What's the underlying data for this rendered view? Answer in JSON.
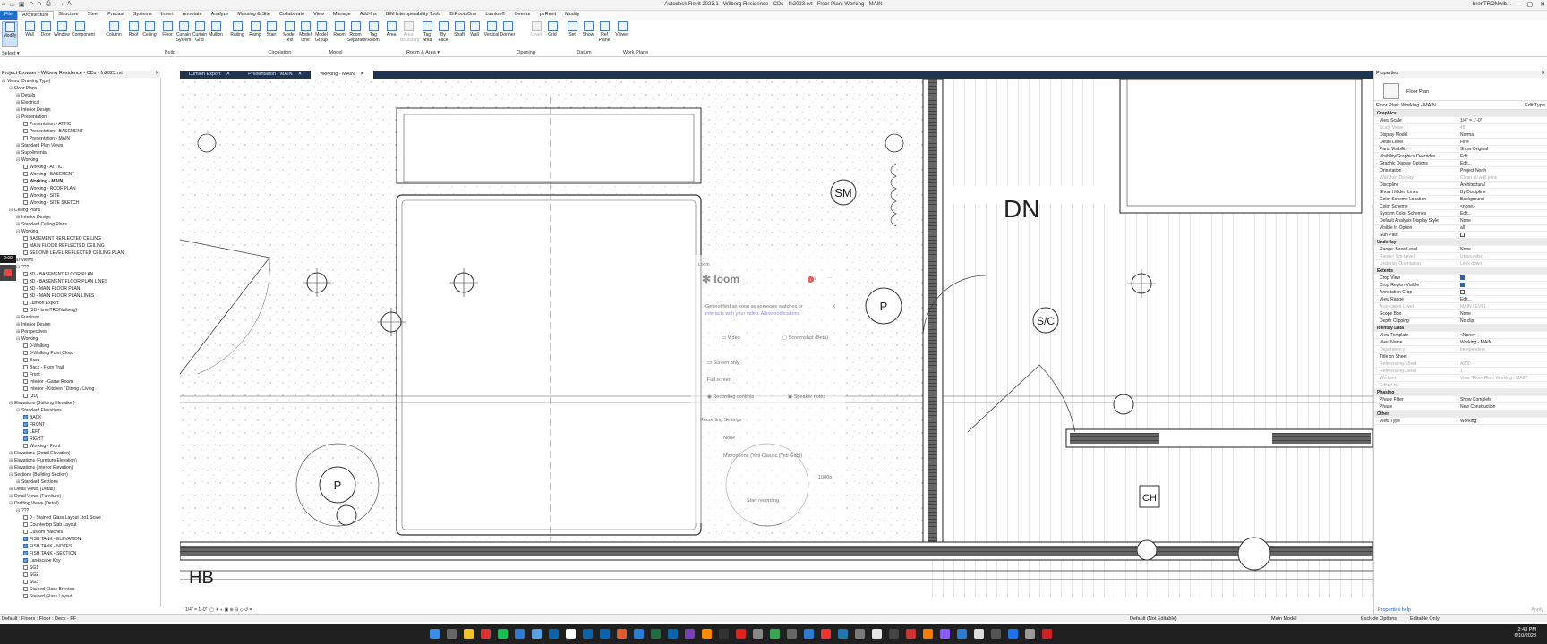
{
  "window": {
    "title": "Autodesk Revit 2023.1 - Wilberg Residence - CDs - fn2023.rvt - Floor Plan: Working - MAIN",
    "user": "brenTRONwib...",
    "qat_icons": [
      "home-icon",
      "open-icon",
      "save-icon",
      "undo-icon",
      "redo-icon",
      "print-icon",
      "measure-icon",
      "text-icon"
    ]
  },
  "ribbon": {
    "tabs": [
      "File",
      "Architecture",
      "Structure",
      "Steel",
      "Precast",
      "Systems",
      "Insert",
      "Annotate",
      "Analyze",
      "Massing & Site",
      "Collaborate",
      "View",
      "Manage",
      "Add-Ins",
      "BIM Interoperability Tools",
      "DiRootsOne",
      "Lumion®",
      "Overtur",
      "pyRevit",
      "Modify"
    ],
    "active_tab": "Architecture",
    "select_label": "Select ▾",
    "buttons": [
      "Modify",
      "Wall",
      "Door",
      "Window",
      "Component",
      "Column",
      "Roof",
      "Ceiling",
      "Floor",
      "Curtain System",
      "Curtain Grid",
      "Mullion",
      "Railing",
      "Ramp",
      "Stair",
      "Model Text",
      "Model Line",
      "Model Group",
      "Room",
      "Room Separator",
      "Tag Room",
      "Area",
      "Area Boundary",
      "Tag Area",
      "By Face",
      "Shaft",
      "Wall",
      "Vertical",
      "Dormer",
      "Level",
      "Grid",
      "Set",
      "Show",
      "Ref Plane",
      "Viewer"
    ],
    "panels": [
      "Build",
      "Circulation",
      "Model",
      "Room & Area ▾",
      "Opening",
      "Datum",
      "Work Plane"
    ]
  },
  "browser": {
    "title": "Project Browser - Wilberg Residence - CDs - fn2023.rvt",
    "items": [
      {
        "t": "Views (Drawing Type)",
        "l": 0,
        "tg": "⊟"
      },
      {
        "t": "Floor Plans",
        "l": 1,
        "tg": "⊟"
      },
      {
        "t": "Details",
        "l": 2,
        "tg": "⊞"
      },
      {
        "t": "Electrical",
        "l": 2,
        "tg": "⊞"
      },
      {
        "t": "Interior Design",
        "l": 2,
        "tg": "⊞"
      },
      {
        "t": "Presentation",
        "l": 2,
        "tg": "⊟"
      },
      {
        "t": "Presentation - ATTIC",
        "l": 3,
        "sq": 1
      },
      {
        "t": "Presentation - BASEMENT",
        "l": 3,
        "sq": 1
      },
      {
        "t": "Presentation - MAIN",
        "l": 3,
        "sq": 1
      },
      {
        "t": "Standard Plan Views",
        "l": 2,
        "tg": "⊞"
      },
      {
        "t": "Supplimental",
        "l": 2,
        "tg": "⊞"
      },
      {
        "t": "Working",
        "l": 2,
        "tg": "⊟"
      },
      {
        "t": "Working - ATTIC",
        "l": 3,
        "sq": 1
      },
      {
        "t": "Working - BASEMENT",
        "l": 3,
        "sq": 1
      },
      {
        "t": "Working - MAIN",
        "l": 3,
        "sq": 1,
        "b": 1
      },
      {
        "t": "Working - ROOF PLAN",
        "l": 3,
        "sq": 1
      },
      {
        "t": "Working - SITE",
        "l": 3,
        "sq": 1
      },
      {
        "t": "Working - SITE SKETCH",
        "l": 3,
        "sq": 1
      },
      {
        "t": "Ceiling Plans",
        "l": 1,
        "tg": "⊟"
      },
      {
        "t": "Interior Design",
        "l": 2,
        "tg": "⊞"
      },
      {
        "t": "Standard Ceiling Plans",
        "l": 2,
        "tg": "⊞"
      },
      {
        "t": "Working",
        "l": 2,
        "tg": "⊟"
      },
      {
        "t": "BASEMENT REFLECTED CEILING",
        "l": 3,
        "sq": 1
      },
      {
        "t": "MAIN FLOOR REFLECTED CEILING",
        "l": 3,
        "sq": 1
      },
      {
        "t": "SECOND LEVEL REFLECTED CEILING PLAN",
        "l": 3,
        "sq": 1
      },
      {
        "t": "3D Views",
        "l": 1,
        "tg": "⊟"
      },
      {
        "t": "???",
        "l": 2,
        "tg": "⊟"
      },
      {
        "t": "3D - BASEMENT FLOOR PLAN",
        "l": 3,
        "sq": 1
      },
      {
        "t": "3D - BASEMENT FLOOR PLAN LINES",
        "l": 3,
        "sq": 1
      },
      {
        "t": "3D - MAIN FLOOR PLAN",
        "l": 3,
        "sq": 1
      },
      {
        "t": "3D - MAIN FLOOR PLAN LINES",
        "l": 3,
        "sq": 1
      },
      {
        "t": "Lumion Export",
        "l": 3,
        "sq": 1
      },
      {
        "t": "{3D - brenTRONwiberg}",
        "l": 3,
        "sq": 1
      },
      {
        "t": "Furniture",
        "l": 2,
        "tg": "⊞"
      },
      {
        "t": "Interior Design",
        "l": 2,
        "tg": "⊞"
      },
      {
        "t": "Perspectives",
        "l": 2,
        "tg": "⊞"
      },
      {
        "t": "Working",
        "l": 2,
        "tg": "⊟"
      },
      {
        "t": "0-Walking",
        "l": 3,
        "sq": 1
      },
      {
        "t": "0-Walking Point Cloud",
        "l": 3,
        "sq": 1
      },
      {
        "t": "Back",
        "l": 3,
        "sq": 1
      },
      {
        "t": "Back - From Trail",
        "l": 3,
        "sq": 1
      },
      {
        "t": "Front",
        "l": 3,
        "sq": 1
      },
      {
        "t": "Interior - Game Room",
        "l": 3,
        "sq": 1
      },
      {
        "t": "Interior - Kitchen / Dining / Living",
        "l": 3,
        "sq": 1
      },
      {
        "t": "{3D}",
        "l": 3,
        "sq": 1
      },
      {
        "t": "Elevations (Building Elevation)",
        "l": 1,
        "tg": "⊟"
      },
      {
        "t": "Standard Elevations",
        "l": 2,
        "tg": "⊟"
      },
      {
        "t": "BACK",
        "l": 3,
        "sq": 2
      },
      {
        "t": "FRONT",
        "l": 3,
        "sq": 2
      },
      {
        "t": "LEFT",
        "l": 3,
        "sq": 2
      },
      {
        "t": "RIGHT",
        "l": 3,
        "sq": 2
      },
      {
        "t": "Working - Front",
        "l": 3,
        "sq": 1
      },
      {
        "t": "Elevations (Detail Elevation)",
        "l": 1,
        "tg": "⊞"
      },
      {
        "t": "Elevations (Furniture Elevation)",
        "l": 1,
        "tg": "⊞"
      },
      {
        "t": "Elevations (Interior Elevation)",
        "l": 1,
        "tg": "⊞"
      },
      {
        "t": "Sections (Building Section)",
        "l": 1,
        "tg": "⊟"
      },
      {
        "t": "Standard Sections",
        "l": 2,
        "tg": "⊞"
      },
      {
        "t": "Detail Views (Detail)",
        "l": 1,
        "tg": "⊞"
      },
      {
        "t": "Detail Views (Furniture)",
        "l": 1,
        "tg": "⊞"
      },
      {
        "t": "Drafting Views (Detail)",
        "l": 1,
        "tg": "⊟"
      },
      {
        "t": "???",
        "l": 2,
        "tg": "⊟"
      },
      {
        "t": "0 - Stained Glass Layout 1to1 Scale",
        "l": 3,
        "sq": 1
      },
      {
        "t": "Countertop Slab Layout",
        "l": 3,
        "sq": 1
      },
      {
        "t": "Custom Hatches",
        "l": 3,
        "sq": 1
      },
      {
        "t": "FISH TANK - ELEVATION",
        "l": 3,
        "sq": 2
      },
      {
        "t": "FISH TANK - NOTES",
        "l": 3,
        "sq": 2
      },
      {
        "t": "FISH TANK - SECTION",
        "l": 3,
        "sq": 2
      },
      {
        "t": "Landscape Key",
        "l": 3,
        "sq": 2
      },
      {
        "t": "SG1",
        "l": 3,
        "sq": 1
      },
      {
        "t": "SG2",
        "l": 3,
        "sq": 1
      },
      {
        "t": "SG3",
        "l": 3,
        "sq": 1
      },
      {
        "t": "Stained Glass Brenton",
        "l": 3,
        "sq": 1
      },
      {
        "t": "Stained Glass Layout",
        "l": 3,
        "sq": 1
      }
    ]
  },
  "recorder": {
    "timer": "0:00"
  },
  "view_tabs": [
    {
      "label": "Lumion Export",
      "active": false
    },
    {
      "label": "Presentation - MAIN",
      "active": false
    },
    {
      "label": "Working - MAIN",
      "active": true
    }
  ],
  "canvas": {
    "tags": [
      "SM",
      "DN",
      "S/C",
      "P",
      "P",
      "CH",
      "HB"
    ]
  },
  "view_control": {
    "scale": "1/4\" = 1'-0\""
  },
  "loom": {
    "brand": "loom",
    "header": "Loom",
    "notice": "Get notified as soon as someone watches or",
    "notice2": "interacts with your video. Allow notifications",
    "mode_video": "Video",
    "mode_screenshot": "Screenshot (Beta)",
    "source": "Screen only",
    "area": "Full screen",
    "controls_label": "Recording controls",
    "notes_label": "Speaker notes",
    "settings_label": "Recording Settings",
    "camera": "None",
    "microphone": "Microphone (Yeti Classic (Yeti Gab))",
    "resolution": "1080p",
    "start": "Start recording"
  },
  "properties": {
    "title": "Properties",
    "type_name": "Floor Plan",
    "instance": "Floor Plan: Working - MAIN",
    "edit_type": "Edit Type",
    "rows": [
      {
        "k": "Graphics",
        "cat": 1
      },
      {
        "k": "View Scale",
        "v": "1/4\" = 1'-0\""
      },
      {
        "k": "Scale Value 1:",
        "v": "48",
        "d": 1
      },
      {
        "k": "Display Model",
        "v": "Normal"
      },
      {
        "k": "Detail Level",
        "v": "Fine"
      },
      {
        "k": "Parts Visibility",
        "v": "Show Original"
      },
      {
        "k": "Visibility/Graphics Overrides",
        "v": "Edit..."
      },
      {
        "k": "Graphic Display Options",
        "v": "Edit..."
      },
      {
        "k": "Orientation",
        "v": "Project North"
      },
      {
        "k": "Wall Join Display",
        "v": "Clean all wall joins",
        "d": 1
      },
      {
        "k": "Discipline",
        "v": "Architectural"
      },
      {
        "k": "Show Hidden Lines",
        "v": "By Discipline"
      },
      {
        "k": "Color Scheme Location",
        "v": "Background"
      },
      {
        "k": "Color Scheme",
        "v": "<none>"
      },
      {
        "k": "System Color Schemes",
        "v": "Edit..."
      },
      {
        "k": "Default Analysis Display Style",
        "v": "None"
      },
      {
        "k": "Visible In Option",
        "v": "all"
      },
      {
        "k": "Sun Path",
        "cb": 0
      },
      {
        "k": "Underlay",
        "cat": 1
      },
      {
        "k": "Range: Base Level",
        "v": "None"
      },
      {
        "k": "Range: Top Level",
        "v": "Unbounded",
        "d": 1
      },
      {
        "k": "Underlay Orientation",
        "v": "Look down",
        "d": 1
      },
      {
        "k": "Extents",
        "cat": 1
      },
      {
        "k": "Crop View",
        "cb": 1
      },
      {
        "k": "Crop Region Visible",
        "cb": 1
      },
      {
        "k": "Annotation Crop",
        "cb": 0
      },
      {
        "k": "View Range",
        "v": "Edit..."
      },
      {
        "k": "Associated Level",
        "v": "MAIN LEVEL",
        "d": 1
      },
      {
        "k": "Scope Box",
        "v": "None"
      },
      {
        "k": "Depth Clipping",
        "v": "No clip"
      },
      {
        "k": "Identity Data",
        "cat": 1
      },
      {
        "k": "View Template",
        "v": "<None>"
      },
      {
        "k": "View Name",
        "v": "Working - MAIN"
      },
      {
        "k": "Dependency",
        "v": "Independent",
        "d": 1
      },
      {
        "k": "Title on Sheet",
        "v": ""
      },
      {
        "k": "Referencing Sheet",
        "v": "A200",
        "d": 1
      },
      {
        "k": "Referencing Detail",
        "v": "1",
        "d": 1
      },
      {
        "k": "Workset",
        "v": "View \"Floor Plan: Working - MAIN\"",
        "d": 1
      },
      {
        "k": "Edited by",
        "v": "",
        "d": 1
      },
      {
        "k": "Phasing",
        "cat": 1
      },
      {
        "k": "Phase Filter",
        "v": "Show Complete"
      },
      {
        "k": "Phase",
        "v": "New Construction"
      },
      {
        "k": "Other",
        "cat": 1
      },
      {
        "k": "View Type",
        "v": "Working"
      }
    ],
    "help": "Properties help",
    "apply": "Apply"
  },
  "status": {
    "left": "Default : Floors : Floor : Deck - FF",
    "workset": "Default (Not Editable)",
    "model": "Main Model",
    "exclude": "Exclude Options",
    "editable": "Editable Only"
  },
  "clock": {
    "time": "2:43 PM",
    "date": "6/10/2023"
  }
}
